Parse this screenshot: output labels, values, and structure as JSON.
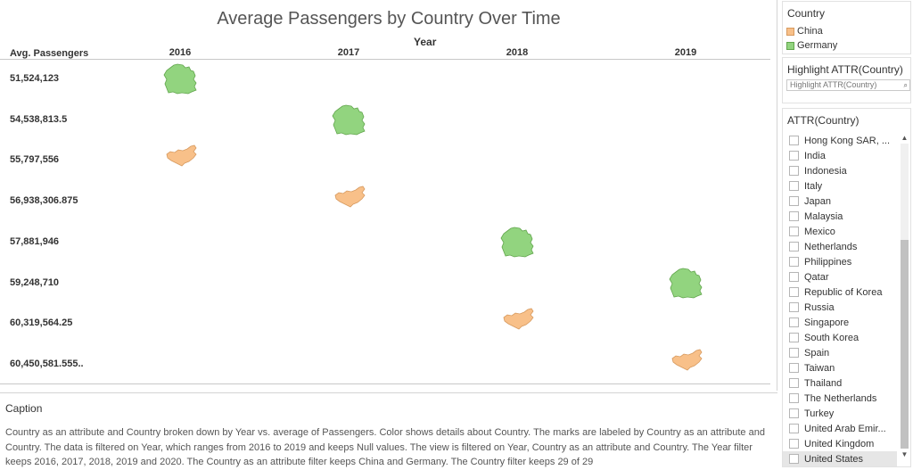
{
  "chart": {
    "title": "Average Passengers by Country Over Time",
    "column_title": "Year",
    "row_header": "Avg. Passengers",
    "colors": {
      "China": "#f8c089",
      "Germany": "#92d47f"
    },
    "chart_data": {
      "type": "scatter",
      "title": "Average Passengers by Country Over Time",
      "xlabel": "Year",
      "ylabel": "Avg. Passengers",
      "categories": [
        "2016",
        "2017",
        "2018",
        "2019"
      ],
      "rows": [
        "51,524,123",
        "54,538,813.5",
        "55,797,556",
        "56,938,306.875",
        "57,881,946",
        "59,248,710",
        "60,319,564.25",
        "60,450,581.555.."
      ],
      "series": [
        {
          "name": "China",
          "marks": [
            {
              "year": "2016",
              "value": "55,797,556"
            },
            {
              "year": "2017",
              "value": "56,938,306.875"
            },
            {
              "year": "2018",
              "value": "60,319,564.25"
            },
            {
              "year": "2019",
              "value": "60,450,581.555.."
            }
          ]
        },
        {
          "name": "Germany",
          "marks": [
            {
              "year": "2016",
              "value": "51,524,123"
            },
            {
              "year": "2017",
              "value": "54,538,813.5"
            },
            {
              "year": "2018",
              "value": "57,881,946"
            },
            {
              "year": "2019",
              "value": "59,248,710"
            }
          ]
        }
      ]
    }
  },
  "caption": {
    "title": "Caption",
    "text": "Country as an attribute and Country broken down by Year vs. average of Passengers.  Color shows details about Country.  The marks are labeled by Country as an attribute and Country. The data is filtered on Year, which ranges from 2016 to 2019 and keeps Null values. The view is filtered on Year, Country as an attribute and Country. The Year filter keeps 2016, 2017, 2018, 2019 and 2020. The Country as an attribute filter keeps China and Germany. The Country filter keeps 29 of 29"
  },
  "legend": {
    "title": "Country",
    "items": [
      {
        "label": "China",
        "color": "#f8c089"
      },
      {
        "label": "Germany",
        "color": "#92d47f"
      }
    ]
  },
  "highlight": {
    "title": "Highlight ATTR(Country)",
    "placeholder": "Highlight ATTR(Country)"
  },
  "filter": {
    "title": "ATTR(Country)",
    "items": [
      "Hong Kong SAR, ...",
      "India",
      "Indonesia",
      "Italy",
      "Japan",
      "Malaysia",
      "Mexico",
      "Netherlands",
      "Philippines",
      "Qatar",
      "Republic of Korea",
      "Russia",
      "Singapore",
      "South Korea",
      "Spain",
      "Taiwan",
      "Thailand",
      "The Netherlands",
      "Turkey",
      "United Arab Emir...",
      "United Kingdom",
      "United States"
    ],
    "selected": "United States"
  }
}
